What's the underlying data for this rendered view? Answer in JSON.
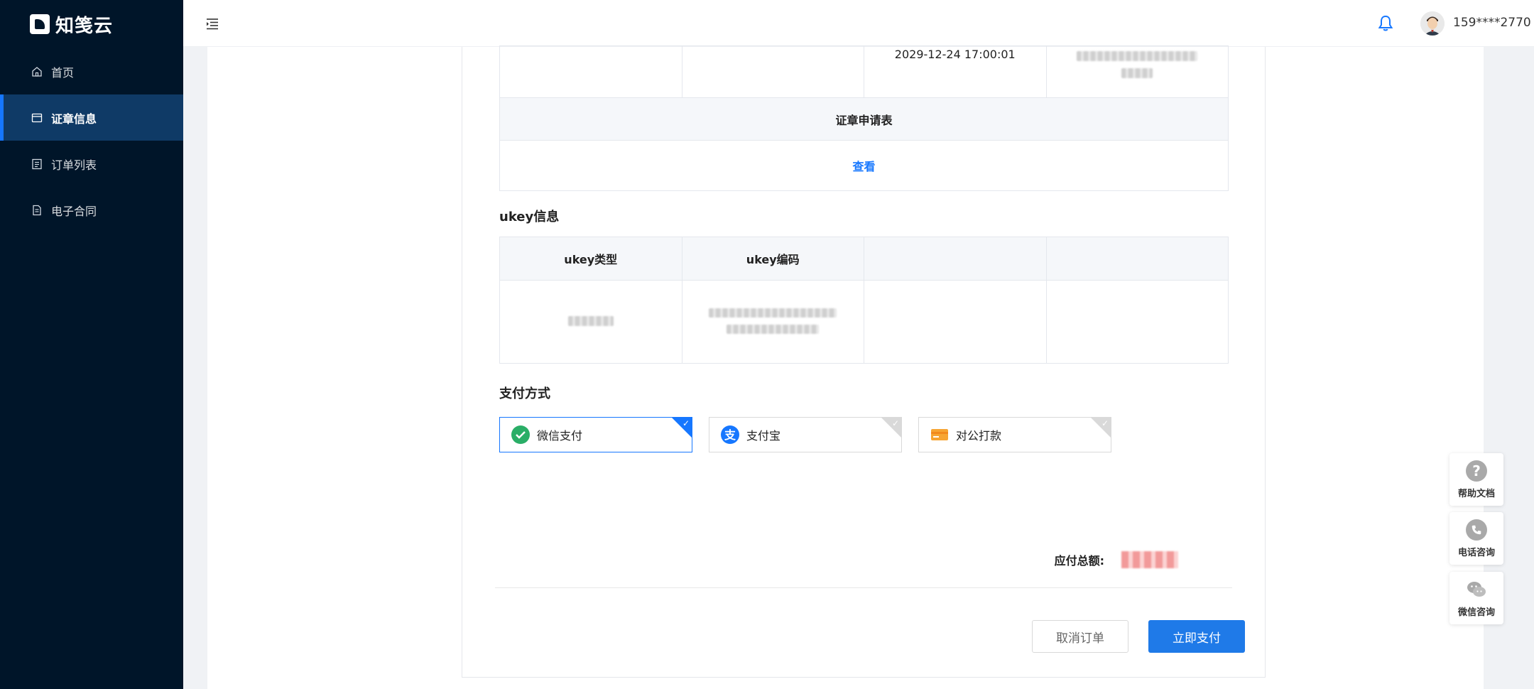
{
  "brand": {
    "name": "知笺云"
  },
  "sidebar": {
    "items": [
      {
        "label": "首页",
        "icon": "home-icon"
      },
      {
        "label": "证章信息",
        "icon": "card-icon",
        "active": true
      },
      {
        "label": "订单列表",
        "icon": "list-icon"
      },
      {
        "label": "电子合同",
        "icon": "contract-icon"
      }
    ]
  },
  "header": {
    "username": "159****2770"
  },
  "cert_table": {
    "row_top": [
      "",
      "",
      "2029-12-24 17:00:01",
      ""
    ],
    "form_header": "证章申请表",
    "view_link": "查看"
  },
  "ukey": {
    "title": "ukey信息",
    "headers": [
      "ukey类型",
      "ukey编码",
      "",
      ""
    ]
  },
  "payment": {
    "title": "支付方式",
    "options": [
      {
        "label": "微信支付",
        "selected": true
      },
      {
        "label": "支付宝",
        "selected": false
      },
      {
        "label": "对公打款",
        "selected": false
      }
    ],
    "total_label": "应付总额:"
  },
  "actions": {
    "cancel": "取消订单",
    "pay": "立即支付"
  },
  "float_tools": [
    {
      "label": "帮助文档"
    },
    {
      "label": "电话咨询"
    },
    {
      "label": "微信咨询"
    }
  ],
  "colors": {
    "sidebar_bg": "#001529",
    "active_bg": "#0f3a66",
    "primary": "#1677ff"
  }
}
